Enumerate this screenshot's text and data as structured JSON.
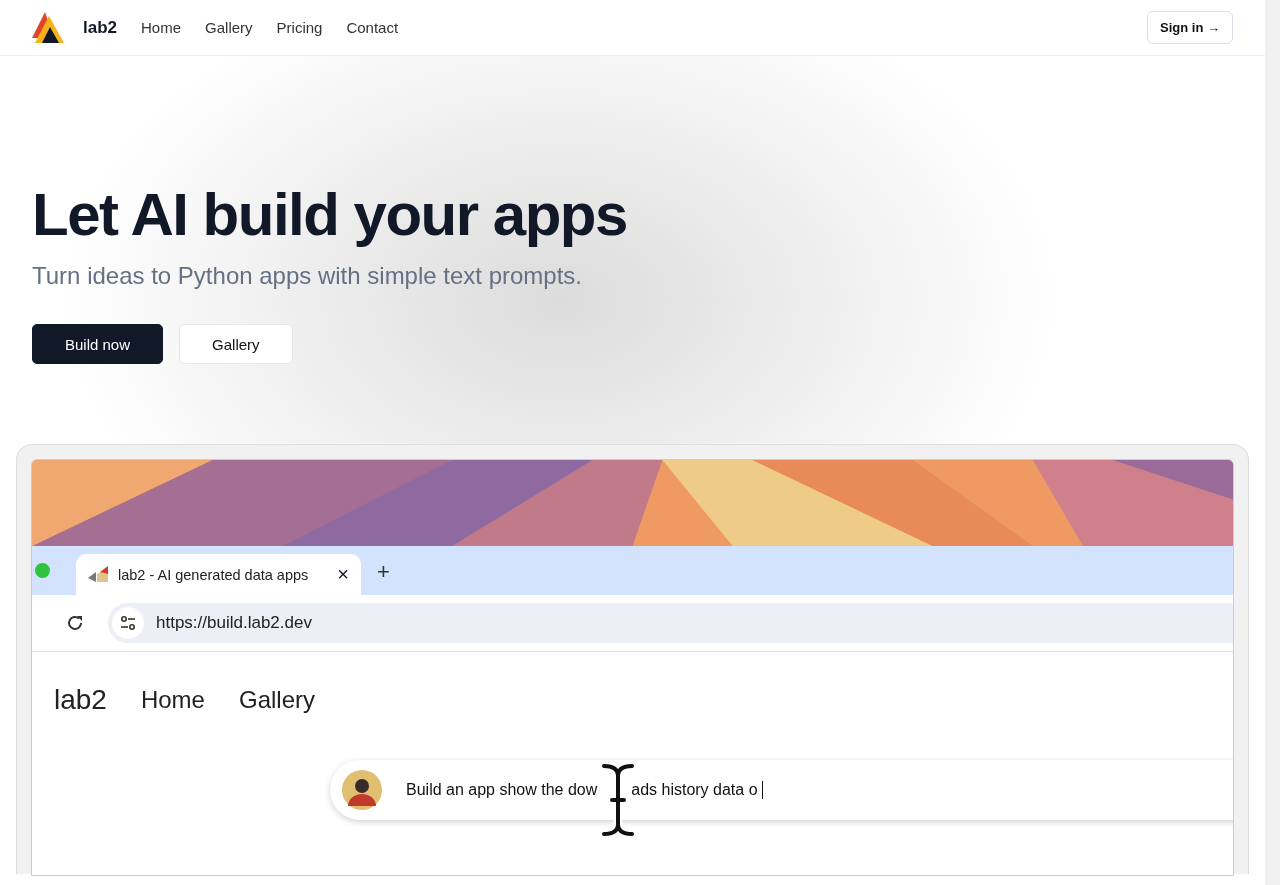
{
  "nav": {
    "brand": "lab2",
    "links": [
      {
        "label": "Home"
      },
      {
        "label": "Gallery"
      },
      {
        "label": "Pricing"
      },
      {
        "label": "Contact"
      }
    ],
    "sign_in": "Sign in →"
  },
  "hero": {
    "title": "Let AI build your apps",
    "subtitle": "Turn ideas to Python apps with simple text prompts.",
    "buttons": [
      {
        "label": "Build now",
        "kind": "primary"
      },
      {
        "label": "Gallery",
        "kind": "secondary"
      }
    ]
  },
  "preview": {
    "browser_tab": {
      "title": "lab2 - AI generated data apps",
      "close": "×",
      "new_tab": "+"
    },
    "address": "https://build.lab2.dev",
    "app_nav": {
      "brand": "lab2",
      "links": [
        "Home",
        "Gallery"
      ]
    },
    "prompt": {
      "value_parts": [
        "Build an app show the dow",
        "ads history data o"
      ]
    }
  }
}
